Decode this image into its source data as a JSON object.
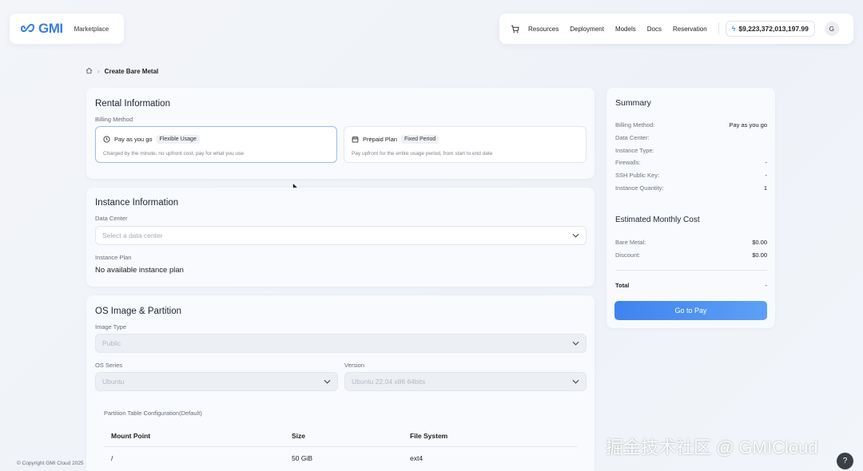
{
  "brand": {
    "logo": "GMI",
    "marketplace": "Marketplace"
  },
  "nav": {
    "links": [
      "Resources",
      "Deployment",
      "Models",
      "Docs",
      "Reservation"
    ],
    "balance": "$9,223,372,013,197.99",
    "avatar": "G",
    "cart_icon": "cart-icon"
  },
  "breadcrumb": {
    "current": "Create Bare Metal"
  },
  "rental": {
    "title": "Rental Information",
    "billing_label": "Billing Method",
    "options": [
      {
        "name": "Pay as you go",
        "tag": "Flexible Usage",
        "desc": "Charged by the minute, no upfront cost, pay for what you use",
        "icon": "clock-icon"
      },
      {
        "name": "Prepaid Plan",
        "tag": "Fixed Period",
        "desc": "Pay upfront for the entire usage period, from start to end date",
        "icon": "calendar-icon"
      }
    ]
  },
  "instance": {
    "title": "Instance Information",
    "dc_label": "Data Center",
    "dc_placeholder": "Select a data center",
    "plan_label": "Instance Plan",
    "plan_value": "No available instance plan"
  },
  "os": {
    "title": "OS Image & Partition",
    "image_type_label": "Image Type",
    "image_type_value": "Public",
    "series_label": "OS Series",
    "series_value": "Ubuntu",
    "version_label": "Version",
    "version_value": "Ubuntu 22.04 x86 64bits",
    "partition_label": "Partition Table Configuration(Default)",
    "table": {
      "headers": [
        "Mount Point",
        "Size",
        "File System"
      ],
      "rows": [
        [
          "/",
          "50 GiB",
          "ext4"
        ]
      ]
    }
  },
  "summary": {
    "title": "Summary",
    "rows": [
      {
        "label": "Billing Method:",
        "value": "Pay as you go"
      },
      {
        "label": "Data Center:",
        "value": ""
      },
      {
        "label": "Instance Type:",
        "value": ""
      },
      {
        "label": "Firewalls:",
        "value": "-"
      },
      {
        "label": "SSH Public Key:",
        "value": "-"
      },
      {
        "label": "Instance Quantity:",
        "value": "1"
      }
    ],
    "cost_title": "Estimated Monthly Cost",
    "cost_rows": [
      {
        "label": "Bare Metal:",
        "value": "$0.00"
      },
      {
        "label": "Discount:",
        "value": "$0.00"
      }
    ],
    "total_label": "Total",
    "total_value": "-",
    "pay_button": "Go to Pay"
  },
  "footer": {
    "copyright": "© Copyright GMI Cloud 2025",
    "watermark": "掘金技术社区 @ GMICloud",
    "help": "?"
  }
}
